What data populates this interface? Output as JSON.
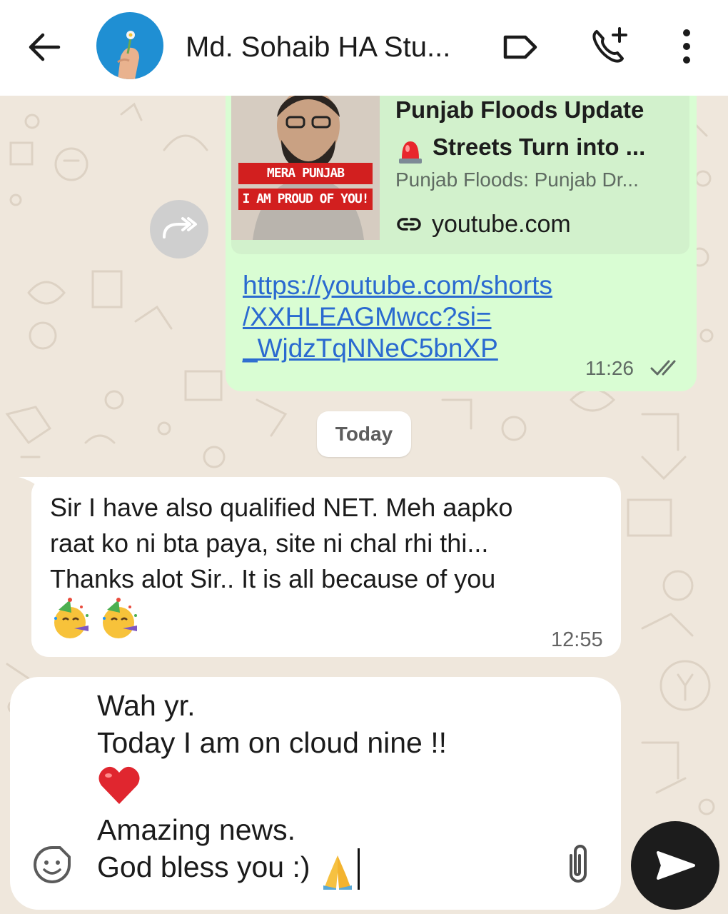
{
  "header": {
    "title": "Md. Sohaib HA Stu..."
  },
  "link_message": {
    "preview_title_line1": "Punjab Floods Update",
    "preview_title_line2": "Streets Turn into ...",
    "preview_description": "Punjab Floods: Punjab Dr...",
    "preview_domain": "youtube.com",
    "thumbnail_text_1": "MERA PUNJAB",
    "thumbnail_text_2": "I AM PROUD OF YOU!",
    "url": "https://youtube.com/shorts/XXHLEAGMwcc?si=_WjdzTqNNeC5bnXP",
    "url_line1": "https://youtube.com/shorts",
    "url_line2": "/XXHLEAGMwcc?si=",
    "url_line3": "_WjdzTqNNeC5bnXP",
    "time": "11:26"
  },
  "date_separator": "Today",
  "incoming_message": {
    "text": "Sir I have also qualified NET. Meh aapko\nraat ko ni bta paya, site ni chal rhi thi...\nThanks alot Sir.. It is all because of you",
    "time": "12:55",
    "emoji_count": 2
  },
  "composer": {
    "line1": "Wah yr.",
    "line2": "Today I am on cloud nine !!",
    "line3": "Amazing news.",
    "line4": "God bless you :)"
  },
  "colors": {
    "outgoing_bubble": "#d9fdd3",
    "link": "#2a6ad0",
    "avatar_bg": "#1f8fd3",
    "send_button": "#1c1c1c"
  }
}
